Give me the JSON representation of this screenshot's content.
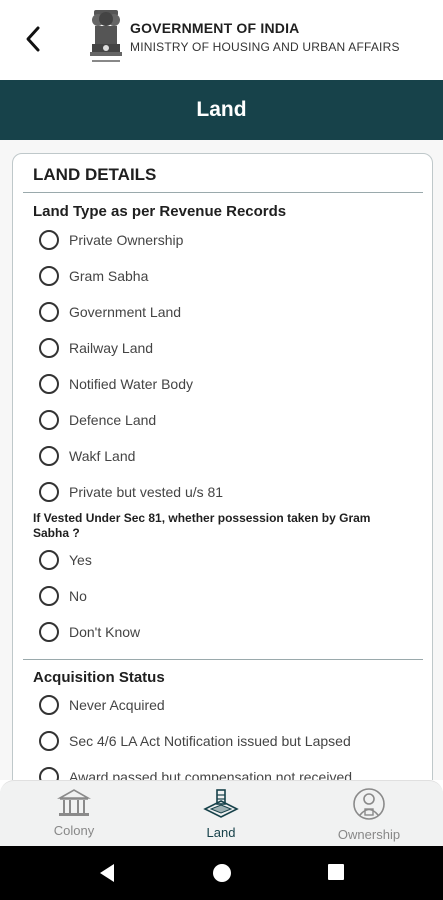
{
  "header": {
    "line1": "GOVERNMENT OF INDIA",
    "line2": "MINISTRY OF HOUSING AND URBAN AFFAIRS",
    "title": "Land"
  },
  "card": {
    "title": "LAND DETAILS",
    "land_type": {
      "heading": "Land Type as per Revenue Records",
      "options": [
        "Private Ownership",
        "Gram Sabha",
        "Government Land",
        "Railway Land",
        "Notified Water Body",
        "Defence Land",
        "Wakf Land",
        "Private but vested u/s 81"
      ]
    },
    "vested": {
      "question": "If Vested Under Sec 81, whether possession taken by Gram Sabha ?",
      "options": [
        "Yes",
        "No",
        "Don't Know"
      ]
    },
    "acquisition": {
      "heading": "Acquisition Status",
      "options": [
        "Never Acquired",
        "Sec 4/6 LA Act Notification issued but Lapsed",
        "Award passed but compensation not received"
      ]
    }
  },
  "bottom_nav": {
    "items": [
      {
        "label": "Colony",
        "icon": "building-icon"
      },
      {
        "label": "Land",
        "icon": "land-plot-icon"
      },
      {
        "label": "Ownership",
        "icon": "owner-person-icon"
      }
    ],
    "active": "Land",
    "active_color": "#17424a",
    "inactive_color": "#888888"
  },
  "colors": {
    "title_bar": "#17424a"
  }
}
